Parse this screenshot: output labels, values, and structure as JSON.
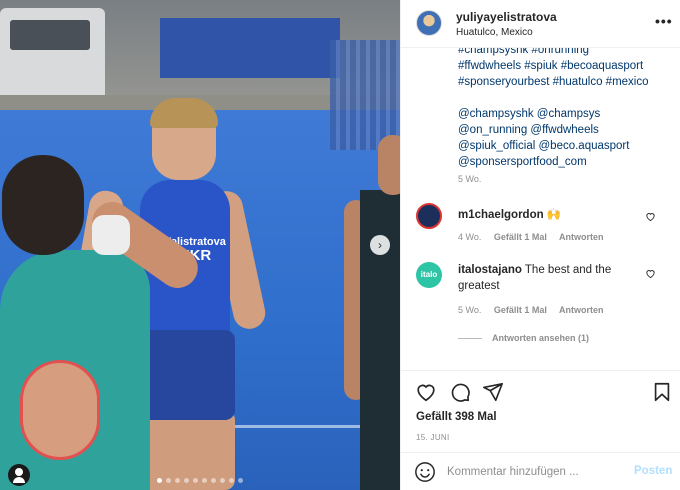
{
  "post": {
    "username": "yuliyayelistratova",
    "location": "Huatulco, Mexico",
    "more_icon": "more-dots-icon",
    "caption_lines": [
      "#champsyshk #onrunning",
      "#ffwdwheels #spiuk #becoaquasport",
      "#sponseryourbest #huatulco #mexico",
      "",
      "@champsyshk @champsys",
      "@on_running @ffwdwheels",
      "@spiuk_official @beco.aquasport",
      "@sponsersportfood_com"
    ],
    "caption_time": "5 Wo."
  },
  "media": {
    "athlete_name": "Yelistratova",
    "athlete_country": "UKR",
    "next_icon": "chevron-right-icon",
    "dot_count": 10,
    "active_dot": 0
  },
  "comments": [
    {
      "user": "m1chaelgordon",
      "text": "🙌",
      "time": "4 Wo.",
      "likes": "Gefällt 1 Mal",
      "reply": "Antworten",
      "avatar_color": "#1c2f5a"
    },
    {
      "user": "italostajano",
      "text": "The best and the greatest",
      "time": "5 Wo.",
      "likes": "Gefällt 1 Mal",
      "reply": "Antworten",
      "avatar_color": "#2ec4a6",
      "avatar_text": "italo"
    }
  ],
  "replies_link": "Antworten ansehen (1)",
  "actions": {
    "likes_text": "Gefällt 398 Mal",
    "date": "15. JUNI"
  },
  "composer": {
    "placeholder": "Kommentar hinzufügen ...",
    "post_label": "Posten"
  },
  "colors": {
    "link": "#00376b",
    "muted": "#8e8e8e",
    "post_disabled": "#b2dffc"
  }
}
